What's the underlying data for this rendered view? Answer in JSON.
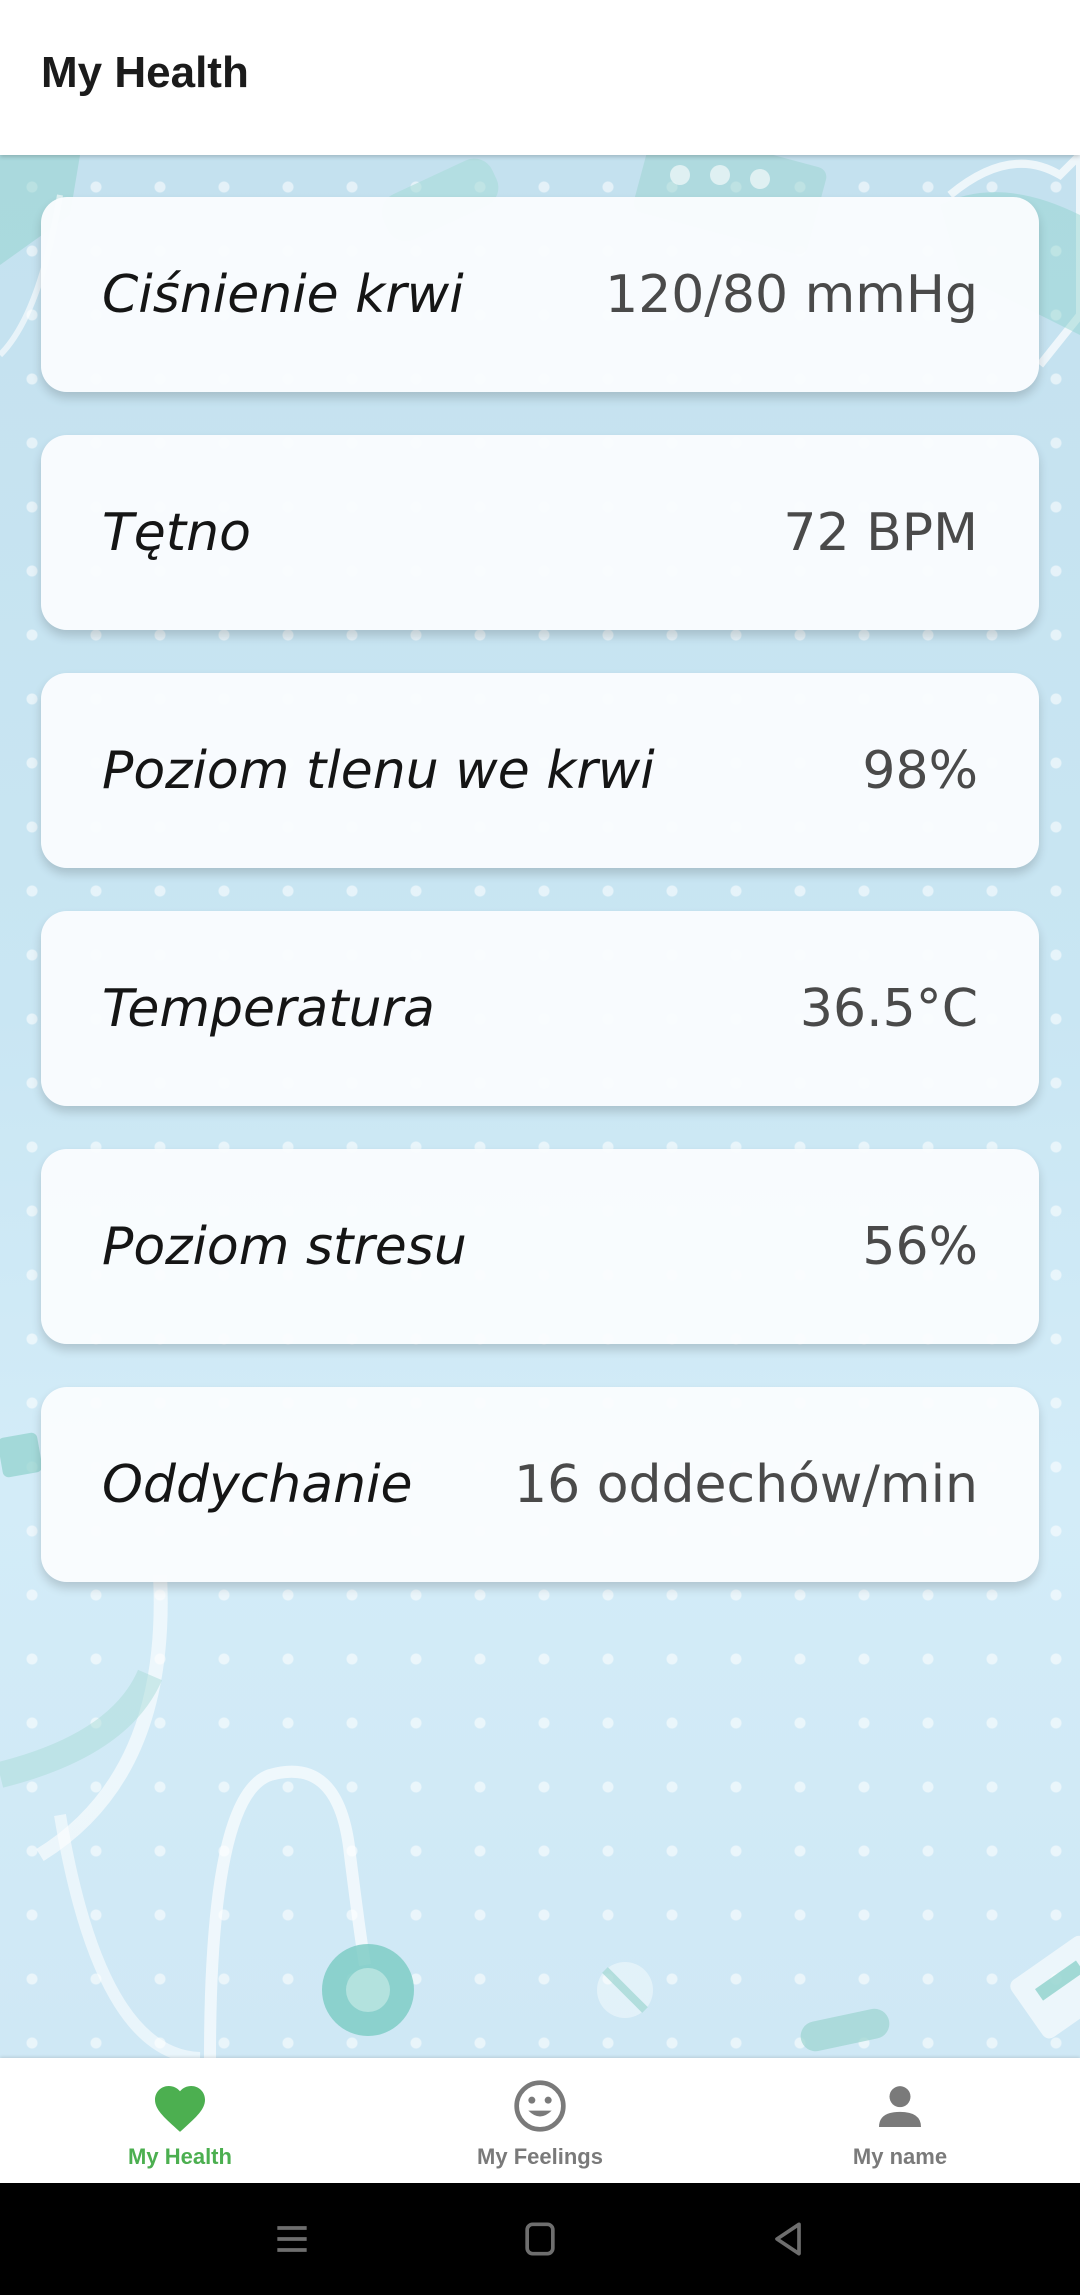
{
  "app_bar": {
    "title": "My Health"
  },
  "metrics": [
    {
      "label": "Ciśnienie krwi",
      "value": "120/80 mmHg"
    },
    {
      "label": "Tętno",
      "value": "72 BPM"
    },
    {
      "label": "Poziom tlenu we krwi",
      "value": "98%"
    },
    {
      "label": "Temperatura",
      "value": "36.5°C"
    },
    {
      "label": "Poziom stresu",
      "value": "56%"
    },
    {
      "label": "Oddychanie",
      "value": "16 oddechów/min"
    }
  ],
  "bottom_nav": {
    "items": [
      {
        "label": "My Health",
        "icon": "heart-icon",
        "active": true
      },
      {
        "label": "My Feelings",
        "icon": "smiley-icon",
        "active": false
      },
      {
        "label": "My name",
        "icon": "person-icon",
        "active": false
      }
    ]
  },
  "system_nav": {
    "icons": [
      "menu-icon",
      "home-icon",
      "back-icon"
    ]
  },
  "colors": {
    "accent": "#4caf50",
    "nav_inactive": "#7a7a7a",
    "background": "#c9e6f3"
  }
}
